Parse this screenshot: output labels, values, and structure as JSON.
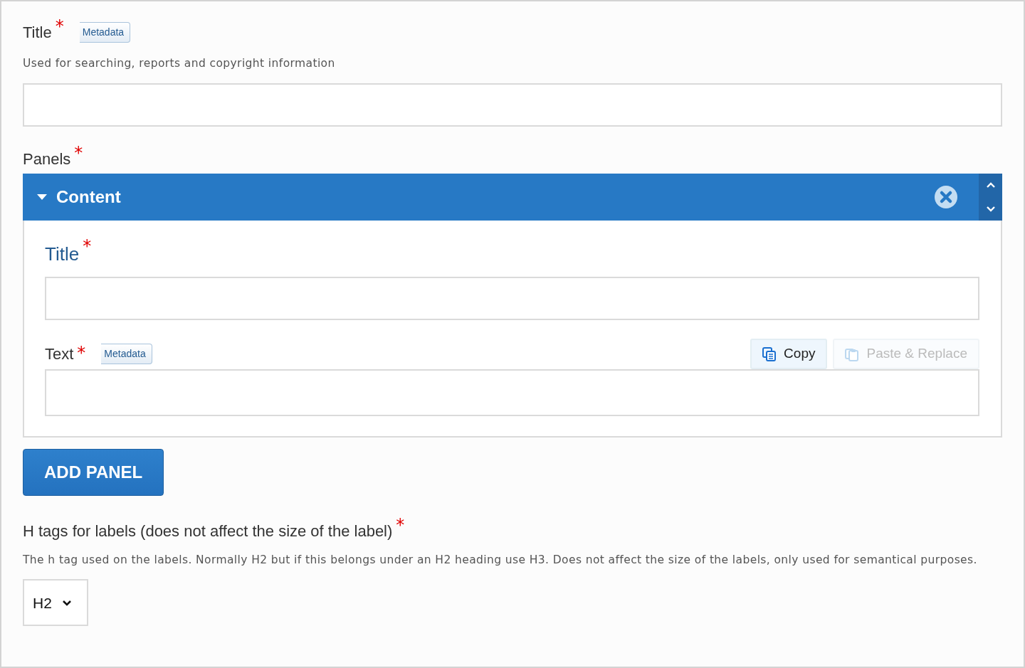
{
  "title_field": {
    "label": "Title",
    "required_mark": "*",
    "tag": "Metadata",
    "description": "Used for searching, reports and copyright information"
  },
  "panels": {
    "label": "Panels",
    "required_mark": "*",
    "items": [
      {
        "heading": "Content",
        "expanded": true,
        "fields": [
          {
            "label": "Title",
            "required_mark": "*",
            "kind": "single"
          },
          {
            "label": "Text",
            "required_mark": "*",
            "tag": "Metadata",
            "kind": "text",
            "actions": [
              {
                "label": "Copy",
                "disabled": false
              },
              {
                "label": "Paste & Replace",
                "disabled": true
              }
            ]
          }
        ]
      }
    ],
    "add_button": "ADD PANEL"
  },
  "h_tags": {
    "label": "H tags for labels (does not affect the size of the label)",
    "required_mark": "*",
    "description": "The h tag used on the labels. Normally H2 but if this belongs under an H2 heading use H3. Does not affect the size of the labels, only used for semantical purposes.",
    "select": {
      "value": "H2"
    }
  }
}
